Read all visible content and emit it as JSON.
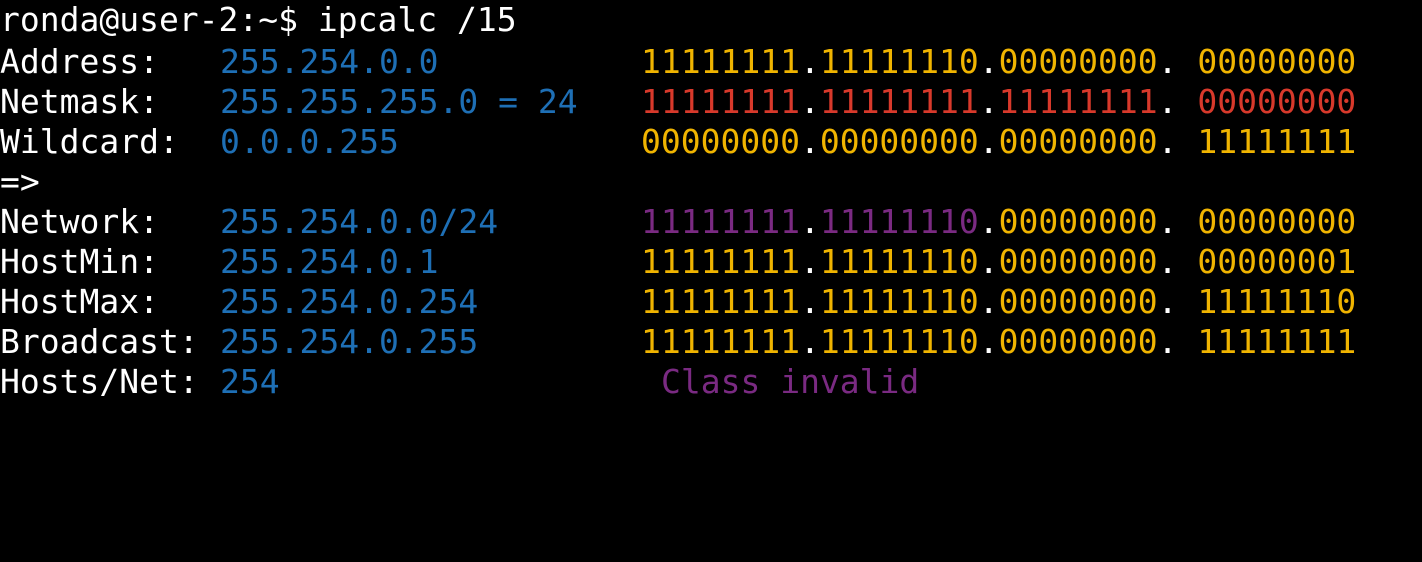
{
  "terminal": {
    "prompt": "ronda@user-2:~$ ipcalc /15",
    "colors": {
      "label": "#ffffff",
      "value": "#1e6fb5",
      "binary_host": "#f0b400",
      "binary_netmask": "#d8392b",
      "binary_network": "#7a2a82",
      "class_note": "#7a2a82",
      "background": "#000000"
    },
    "address": {
      "label": "Address:",
      "value": "255.254.0.0",
      "binary": [
        "11111111",
        "11111110",
        "00000000",
        "00000000"
      ]
    },
    "netmask": {
      "label": "Netmask:",
      "value": "255.255.255.0 = 24",
      "binary": [
        "11111111",
        "11111111",
        "11111111",
        "00000000"
      ]
    },
    "wildcard": {
      "label": "Wildcard:",
      "value": "0.0.0.255",
      "binary": [
        "00000000",
        "00000000",
        "00000000",
        "11111111"
      ]
    },
    "arrow": "=>",
    "network": {
      "label": "Network:",
      "value": "255.254.0.0/24",
      "binary": [
        "11111111",
        "11111110",
        "00000000",
        "00000000"
      ]
    },
    "hostmin": {
      "label": "HostMin:",
      "value": "255.254.0.1",
      "binary": [
        "11111111",
        "11111110",
        "00000000",
        "00000001"
      ]
    },
    "hostmax": {
      "label": "HostMax:",
      "value": "255.254.0.254",
      "binary": [
        "11111111",
        "11111110",
        "00000000",
        "11111110"
      ]
    },
    "broadcast": {
      "label": "Broadcast:",
      "value": "255.254.0.255",
      "binary": [
        "11111111",
        "11111110",
        "00000000",
        "11111111"
      ]
    },
    "hosts": {
      "label": "Hosts/Net:",
      "value": "254",
      "note": "Class invalid"
    }
  }
}
